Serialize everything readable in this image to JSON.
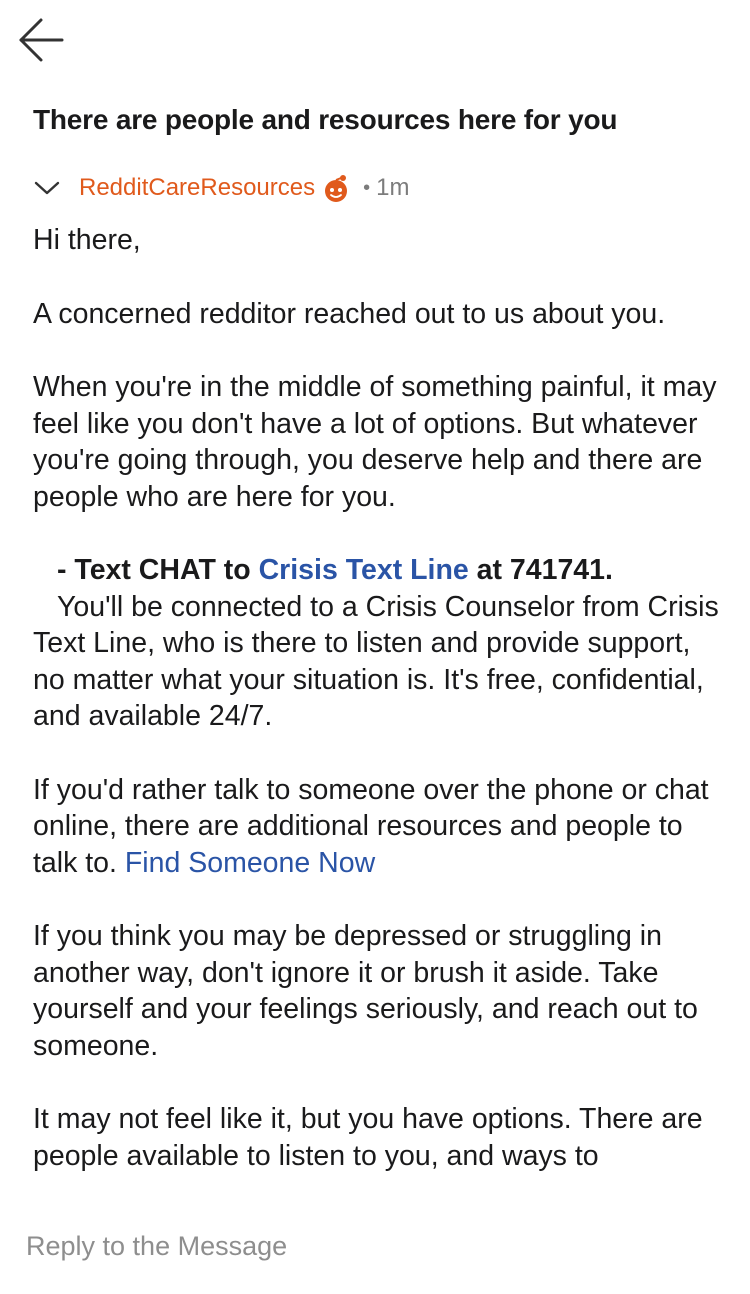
{
  "header": {
    "back_icon": "arrow-left-icon"
  },
  "message": {
    "subject": "There are people and resources here for you",
    "collapse_icon": "chevron-down-icon",
    "author": "RedditCareResources",
    "author_badge_icon": "snoo-avatar-icon",
    "separator": "•",
    "age": "1m",
    "paragraphs": {
      "greeting": "Hi there,",
      "p1": "A concerned redditor reached out to us about you.",
      "p2": "When you're in the middle of something painful, it may feel like you don't have a lot of options. But whatever you're going through, you deserve help and there are people who are here for you.",
      "p3": {
        "prefix": "- Text CHAT to ",
        "link": "Crisis Text Line",
        "suffix": " at 741741.",
        "body": "You'll be connected to a Crisis Counselor from Crisis Text Line, who is there to listen and provide support, no matter what your situation is. It's free, confidential, and available 24/7."
      },
      "p4": {
        "text": "If you'd rather talk to someone over the phone or chat online, there are additional resources and people to talk to. ",
        "link": "Find Someone Now"
      },
      "p5": "If you think you may be depressed or struggling in another way, don't ignore it or brush it aside. Take yourself and your feelings seriously, and reach out to someone.",
      "p6": "It may not feel like it, but you have options. There are people available to listen to you, and ways to"
    }
  },
  "reply": {
    "placeholder": "Reply to the Message"
  },
  "colors": {
    "author": "#e05a1c",
    "link": "#2a54a6",
    "text": "#1a1a1b",
    "muted": "#7c7c7c"
  }
}
